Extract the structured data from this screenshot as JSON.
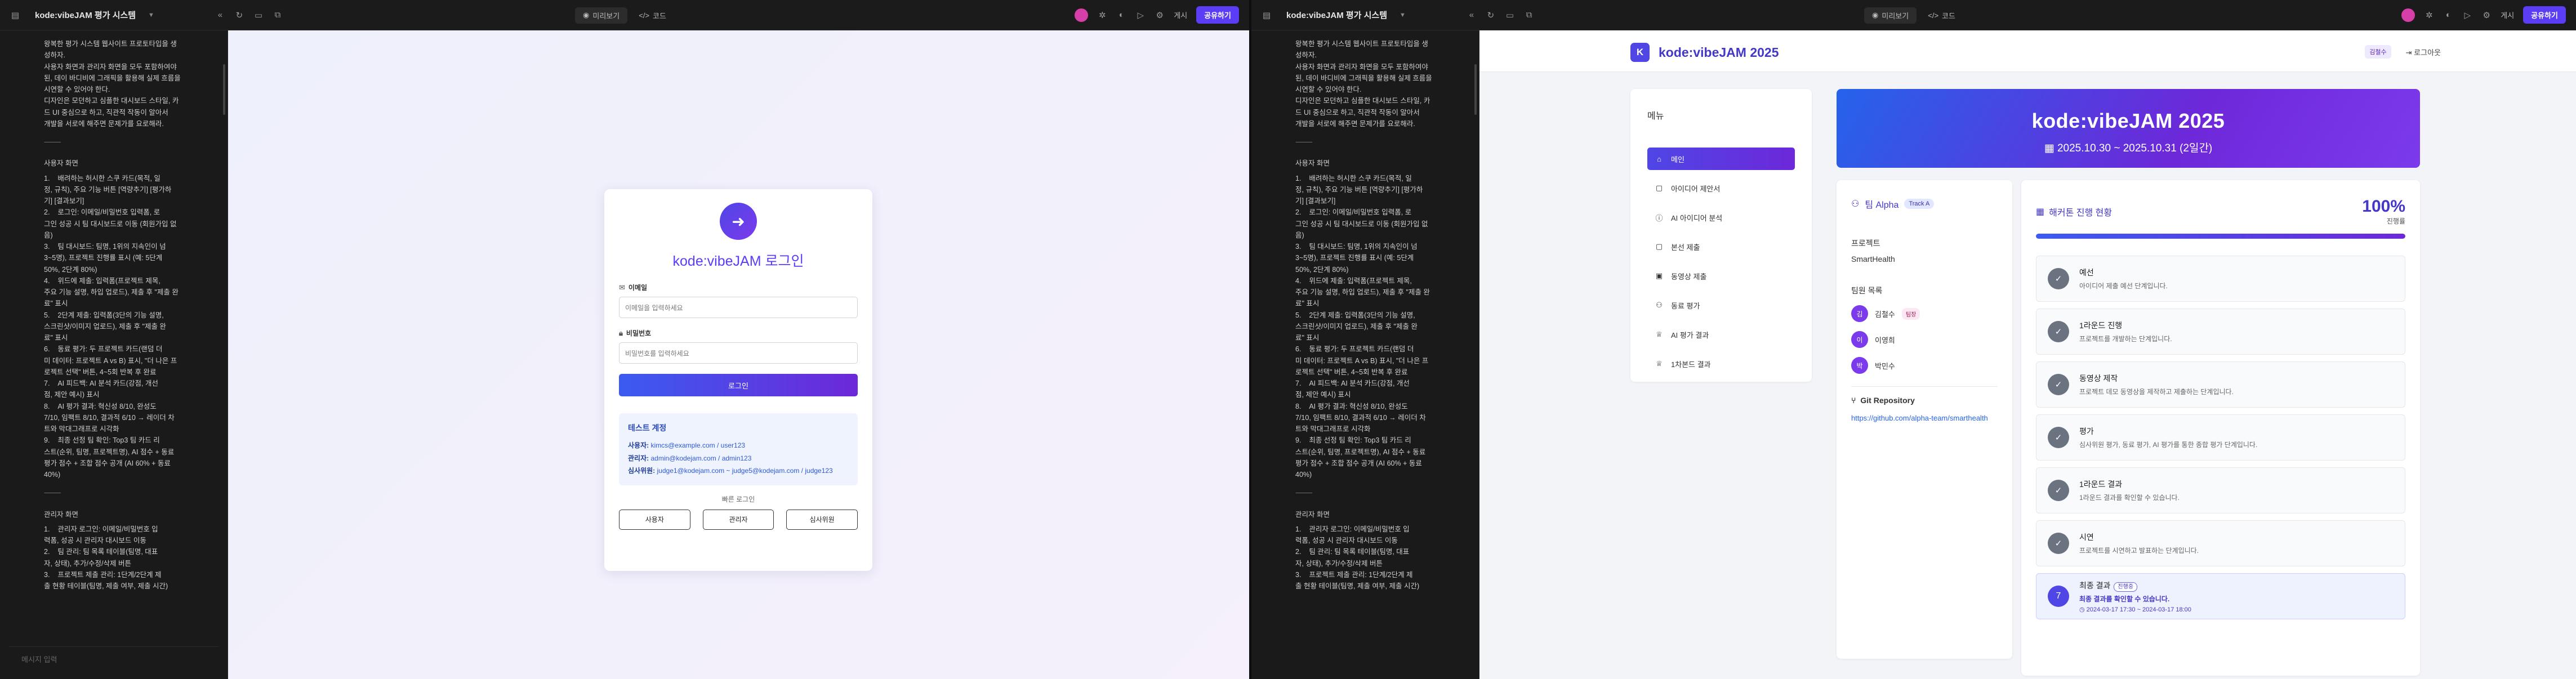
{
  "window": {
    "title": "kode:vibeJAM 평가 시스템",
    "preview_label": "미리보기",
    "code_label": "코드",
    "user_initial": "",
    "settings_label": "게시",
    "share_label": "공유하기"
  },
  "chat": {
    "intro": "왕복한 평가 시스템 웹사이트 프로토타입을 생\n성하자.\n사용자 화면과 관리자 화면을 모두 포함하여야\n된, 데이 바디비에 그래픽을 활용해 실제 흐름을\n시연할 수 있어야 한다.\n디자인은 모던하고 심플한 대시보드 스타일, 카\n드 UI 중심으로 하고, 직관적 작동이 알아서\n개발을 서로에 해주면 문제가를 요로해라.",
    "rule": "⸻",
    "user_section_title": "사용자 화면",
    "user_section": "1.    배려하는 허시한 스쿠 카드(목적, 일\n정, 규칙), 주요 기능 버튼 [역량추기] [평가하\n기] [결과보기]\n2.    로그인: 이메일/비밀번호 입력폼, 로\n그인 성공 시 팀 대시보드로 이동 (회원가입 없\n음)\n3.    팀 대시보드: 팀명, 1위의 지속인이 넘\n3~5명), 프로젝트 진행률 표시 (예: 5단계\n50%, 2단계 80%)\n4.    위드에 제출: 입력폼(프로젝트 제목,\n주요 기능 설명, 하입 업로드), 제출 후 \"제출 완\n료\" 표시\n5.    2단계 제출: 입력폼(3단의 기능 설명,\n스크린샷/이미지 업로드), 제출 후 \"제출 완\n료\" 표시\n6.    동료 평가: 두 프로젝트 카드(랜덤 더\n미 데이터: 프로젝트 A vs B) 표시, \"더 나은 프\n로젝트 선택\" 버튼, 4~5회 반복 후 완료\n7.    AI 피드백: AI 분석 카드(강점, 개선\n점, 제안 예시) 표시\n8.    AI 평가 결과: 혁신성 8/10, 완성도\n7/10, 임팩트 8/10, 결과적 6/10 → 레이더 차\n트와 막대그래프로 시각화\n9.    최종 선정 팀 확인: Top3 팀 카드 리\n스트(순위, 팀명, 프로젝트명), AI 점수 + 동료\n평가 점수 + 조합 점수 공개 (AI 60% + 동료\n40%)",
    "admin_section_title": "관리자 화면",
    "admin_section": "1.    관리자 로그인: 이메일/비밀번호 입\n력폼, 성공 시 관리자 대시보드 이동\n2.    팀 관리: 팀 목록 테이블(팀명, 대표\n자, 상태), 추가/수정/삭제 버튼\n3.    프로젝트 제출 관리: 1단계/2단계 제\n출 현황 테이블(팀명, 제출 여부, 제출 시간)",
    "input_placeholder": "메시지 입력"
  },
  "login": {
    "title": "kode:vibeJAM 로그인",
    "email_label": "이메일",
    "email_placeholder": "이메일을 입력하세요",
    "password_label": "비밀번호",
    "password_placeholder": "비밀번호를 입력하세요",
    "submit_label": "로그인",
    "test_title": "테스트 계정",
    "test_accounts": [
      {
        "role": "사용자:",
        "value": "kimcs@example.com / user123"
      },
      {
        "role": "관리자:",
        "value": "admin@kodejam.com / admin123"
      },
      {
        "role": "심사위원:",
        "value": "judge1@kodejam.com ~ judge5@kodejam.com / judge123"
      }
    ],
    "quick_title": "빠른 로그인",
    "quick_buttons": [
      "사용자",
      "관리자",
      "심사위원"
    ]
  },
  "dashboard": {
    "brand_initial": "K",
    "brand_name": "kode:vibeJAM 2025",
    "user_badge": "김철수",
    "logout_label": "로그아웃",
    "menu_title": "메뉴",
    "menu_items": [
      {
        "label": "메인",
        "icon": "home-icon"
      },
      {
        "label": "아이디어 제안서",
        "icon": "document-icon"
      },
      {
        "label": "AI 아이디어 분석",
        "icon": "info-icon"
      },
      {
        "label": "본선 제출",
        "icon": "document-icon"
      },
      {
        "label": "동영상 제출",
        "icon": "video-icon"
      },
      {
        "label": "동료 평가",
        "icon": "users-icon"
      },
      {
        "label": "AI 평가 결과",
        "icon": "trophy-icon"
      },
      {
        "label": "1차본드 결과",
        "icon": "trophy-icon"
      }
    ],
    "hero_title": "kode:vibeJAM 2025",
    "hero_date": "2025.10.30 ~ 2025.10.31 (2일간)",
    "team": {
      "name": "팀 Alpha",
      "track": "Track A",
      "project_label": "프로젝트",
      "project_value": "SmartHealth",
      "members_label": "팀원 목록",
      "members": [
        {
          "initial": "김",
          "name": "김철수",
          "leader": "팀장"
        },
        {
          "initial": "이",
          "name": "이영희",
          "leader": ""
        },
        {
          "initial": "박",
          "name": "박민수",
          "leader": ""
        }
      ],
      "git_label": "Git Repository",
      "git_url": "https://github.com/alpha-team/smarthealth"
    },
    "progress": {
      "title": "해커톤 진행 현황",
      "percent_text": "100%",
      "percent_value": 1.0,
      "percent_label": "진행률",
      "steps": [
        {
          "name": "예선",
          "desc": "아이디어 제출 예선 단계입니다."
        },
        {
          "name": "1라운드 진행",
          "desc": "프로젝트를 개발하는 단계입니다."
        },
        {
          "name": "동영상 제작",
          "desc": "프로젝트 데모 동영상을 제작하고 제출하는 단계입니다."
        },
        {
          "name": "평가",
          "desc": "심사위원 평가, 동료 평가, AI 평가를 통한 종합 평가 단계입니다."
        },
        {
          "name": "1라운드 결과",
          "desc": "1라운드 결과를 확인할 수 있습니다."
        },
        {
          "name": "시연",
          "desc": "프로젝트를 시연하고 발표하는 단계입니다."
        }
      ],
      "final": {
        "num": "7",
        "name": "최종 결과",
        "badge": "진행중",
        "desc": "최종 결과를 확인할 수 있습니다.",
        "time": "2024-03-17 17:30 ~ 2024-03-17 18:00"
      }
    }
  }
}
